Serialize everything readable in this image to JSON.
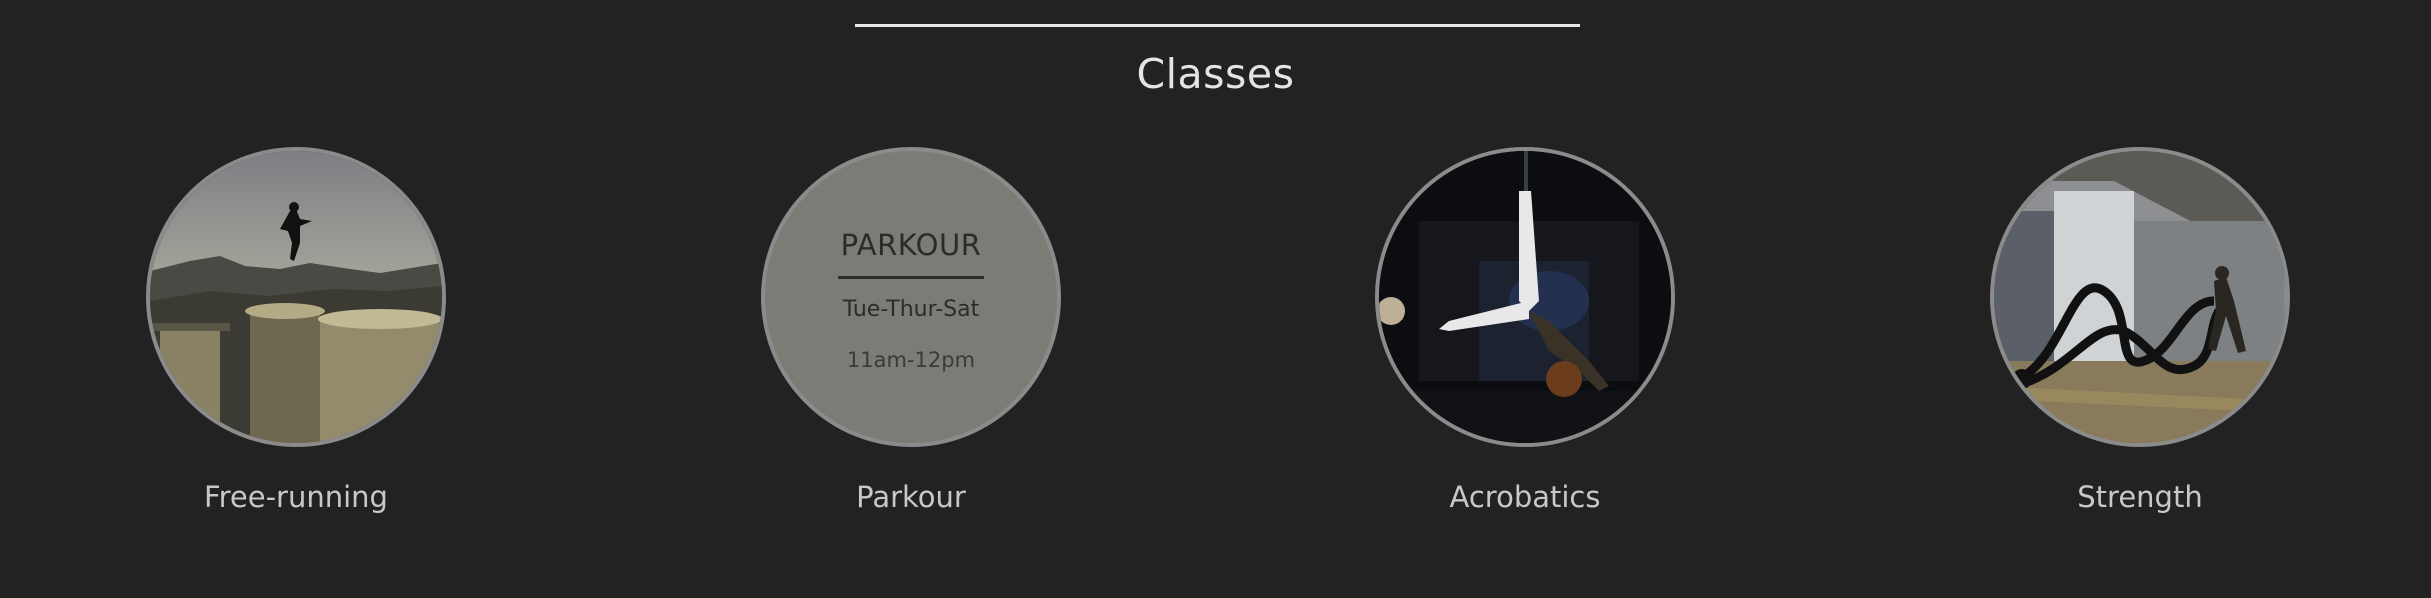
{
  "section": {
    "title": "Classes"
  },
  "classes": [
    {
      "label": "Free-running"
    },
    {
      "label": "Parkour",
      "overlay_title": "PARKOUR",
      "overlay_days": "Tue-Thur-Sat",
      "overlay_time": "11am-12pm"
    },
    {
      "label": "Acrobatics"
    },
    {
      "label": "Strength"
    }
  ],
  "colors": {
    "background": "#222222",
    "divider": "#e8e8e8",
    "circle_border": "#8b8b8b",
    "overlay": "#7c7c76",
    "label": "#c8c8c8"
  }
}
